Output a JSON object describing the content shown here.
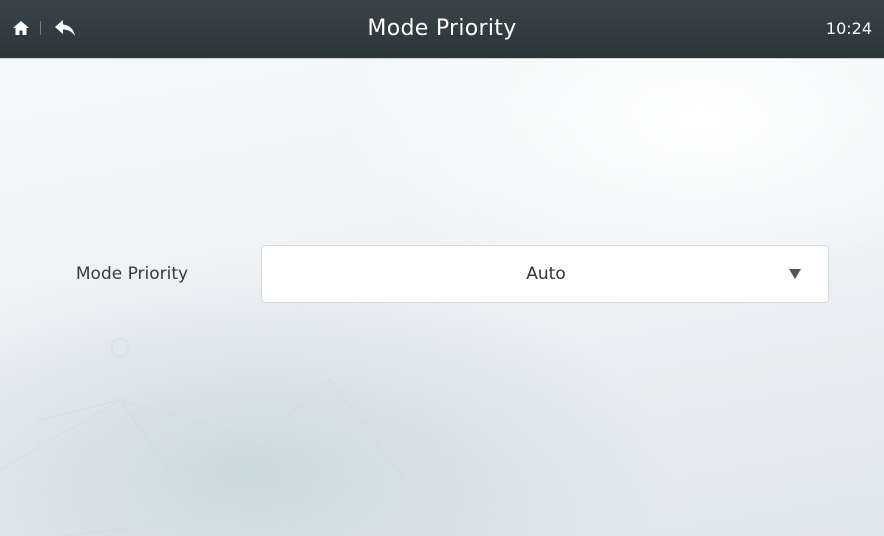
{
  "header": {
    "title": "Mode Priority",
    "time": "10:24",
    "icons": {
      "home": "home-icon",
      "back": "back-arrow-icon"
    }
  },
  "setting": {
    "label": "Mode Priority",
    "selected_value": "Auto",
    "dropdown_icon": "triangle-down-icon"
  },
  "colors": {
    "header_bg": "#2b3538",
    "header_text": "#ffffff",
    "label_text": "#3a3a3a",
    "dropdown_bg": "#ffffff"
  }
}
